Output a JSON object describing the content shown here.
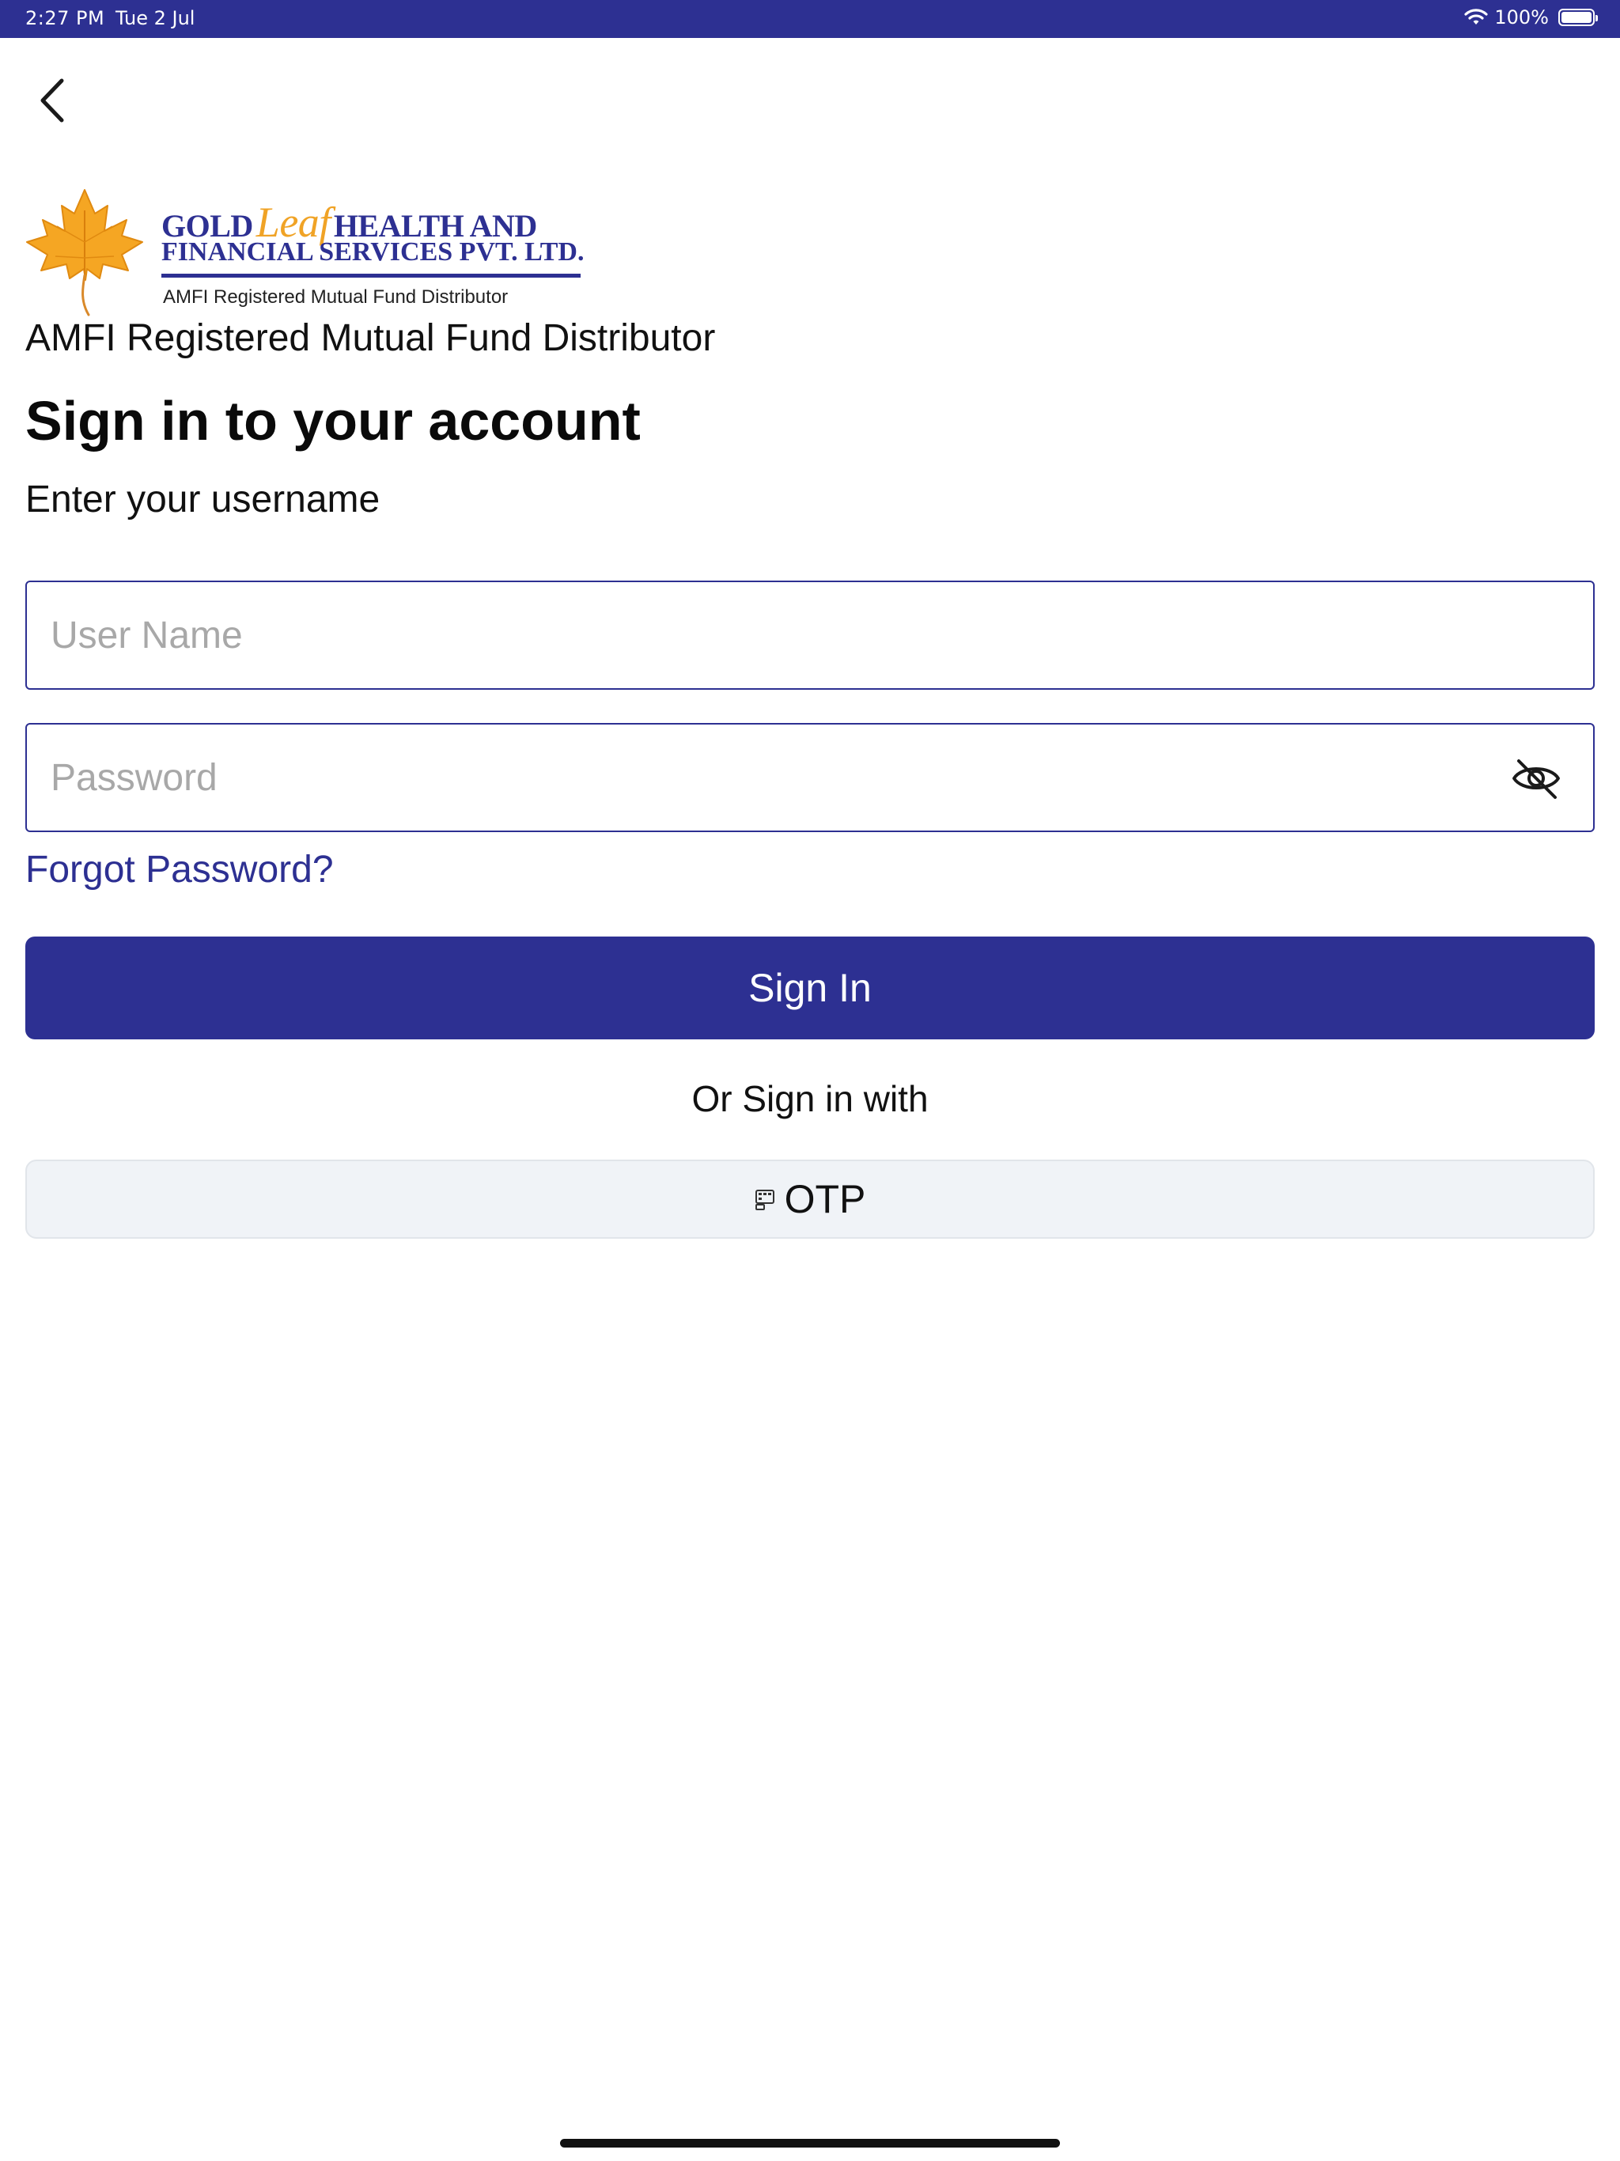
{
  "status_bar": {
    "time": "2:27 PM",
    "date": "Tue 2 Jul",
    "battery": "100%",
    "wifi_icon": "wifi-icon",
    "battery_icon": "battery-icon"
  },
  "nav": {
    "back_icon": "chevron-left-icon"
  },
  "logo": {
    "line1_part1": "GOLD",
    "line1_script": "Leaf",
    "line1_part2": "HEALTH AND",
    "line2": "FINANCIAL SERVICES PVT. LTD.",
    "tagline": "AMFI Registered Mutual Fund Distributor",
    "colors": {
      "navy": "#2d3092",
      "gold": "#f0a326"
    }
  },
  "header": {
    "amfi_text": "AMFI Registered Mutual Fund Distributor",
    "title": "Sign in to your account",
    "subtitle": "Enter your username"
  },
  "form": {
    "username": {
      "value": "",
      "placeholder": "User Name"
    },
    "password": {
      "value": "",
      "placeholder": "Password",
      "visibility_icon": "eye-off-icon"
    },
    "forgot_password": "Forgot Password?",
    "signin_label": "Sign In",
    "or_text": "Or Sign in with",
    "otp_label": "OTP",
    "otp_icon": "dialpad-icon"
  },
  "theme": {
    "primary": "#2d3092",
    "secondary_button_bg": "#f0f3f7"
  }
}
